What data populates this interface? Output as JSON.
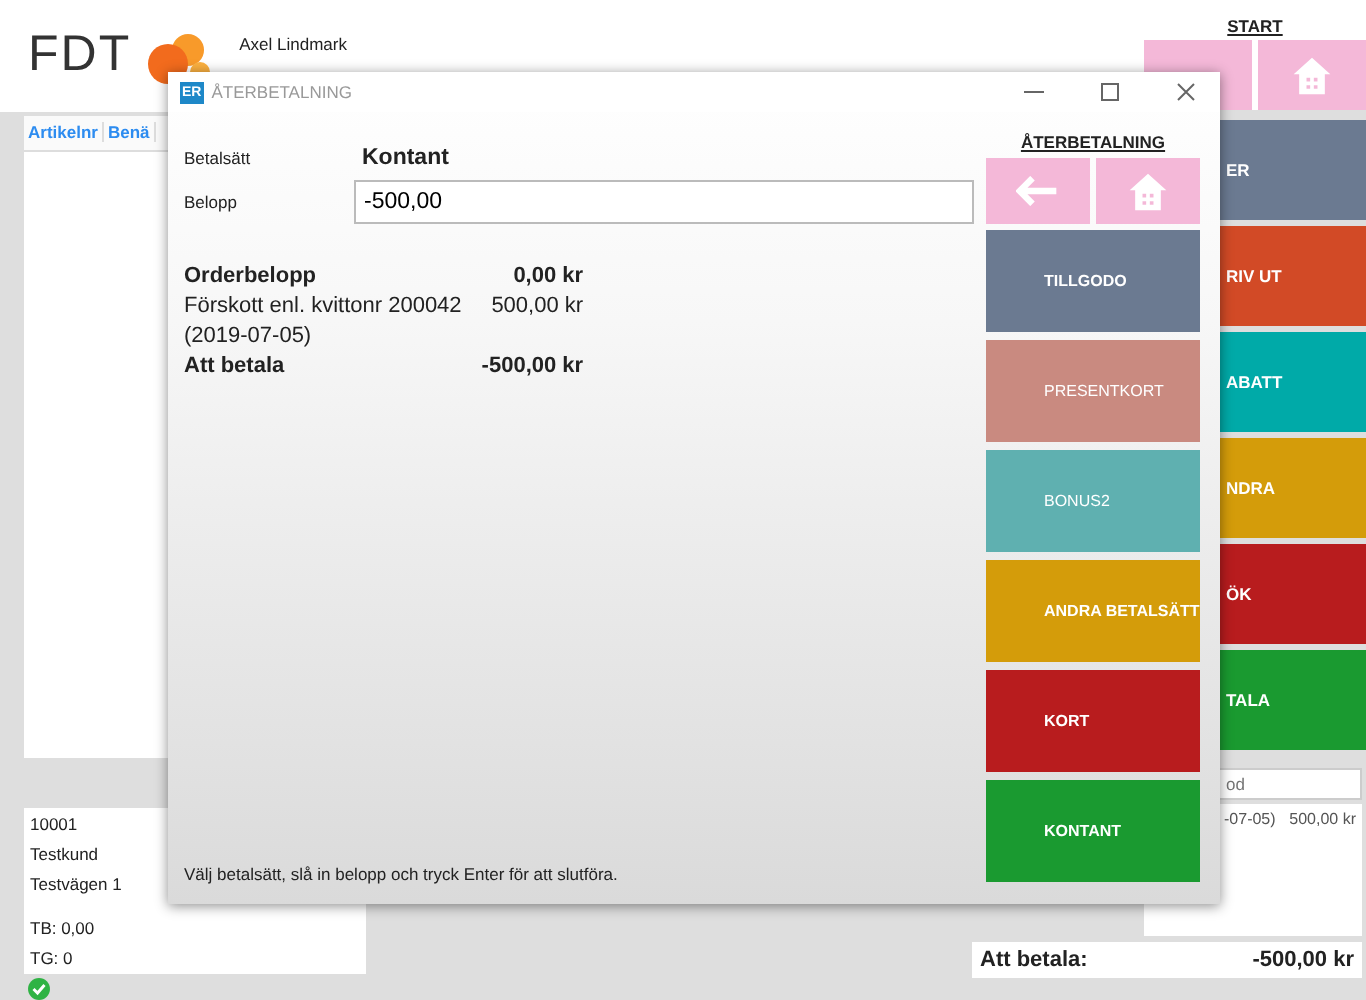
{
  "app": {
    "logo": "FDT",
    "user": "Axel Lindmark"
  },
  "table": {
    "columns": [
      "Artikelnr",
      "Benä"
    ]
  },
  "customer": {
    "groups": [
      [
        "10001",
        "Testkund",
        "Testvägen 1"
      ],
      [
        "TB: 0,00",
        "TG: 0"
      ]
    ],
    "ok": true
  },
  "side_panel": {
    "title": "START",
    "buttons": [
      {
        "label": "ER",
        "color": "#6b7a91"
      },
      {
        "label": "RIV UT",
        "color": "#d24a26"
      },
      {
        "label": "ABATT",
        "color": "#00aaa8"
      },
      {
        "label": "NDRA",
        "color": "#d49c0a"
      },
      {
        "label": "ÖK",
        "color": "#b81c1e"
      },
      {
        "label": "TALA",
        "color": "#1a9a30"
      }
    ],
    "search": {
      "placeholder": "od"
    },
    "rows": [
      {
        "text": "-07-05)",
        "amount": "500,00 kr"
      }
    ],
    "total": {
      "label": "Att betala:",
      "value": "-500,00 kr"
    }
  },
  "dialog": {
    "icon": "ER",
    "title": "ÅTERBETALNING",
    "fields": [
      {
        "kind": "value",
        "label": "Betalsätt",
        "value": "Kontant"
      },
      {
        "kind": "input",
        "label": "Belopp",
        "value": "-500,00"
      }
    ],
    "summary": [
      {
        "label": "Orderbelopp",
        "amount": "0,00 kr",
        "bold": true
      },
      {
        "label": "Förskott enl. kvittonr 200042",
        "note": "(2019-07-05)",
        "amount": "500,00 kr",
        "bold": false
      },
      {
        "label": "Att betala",
        "amount": "-500,00 kr",
        "bold": true
      }
    ],
    "panel_title": "ÅTERBETALNING",
    "buttons": [
      {
        "label": "TILLGODO",
        "color": "#6b7a91",
        "disabled": false
      },
      {
        "label": "PRESENTKORT",
        "color": "#c98a80",
        "disabled": true
      },
      {
        "label": "BONUS2",
        "color": "#5fb0b0",
        "disabled": true
      },
      {
        "label": "ANDRA BETALSÄTT",
        "color": "#d49c0a",
        "disabled": false
      },
      {
        "label": "KORT",
        "color": "#b81c1e",
        "disabled": false
      },
      {
        "label": "KONTANT",
        "color": "#1a9a30",
        "disabled": false
      }
    ],
    "hint": "Välj betalsätt, slå in belopp och tryck Enter för att slutföra."
  }
}
